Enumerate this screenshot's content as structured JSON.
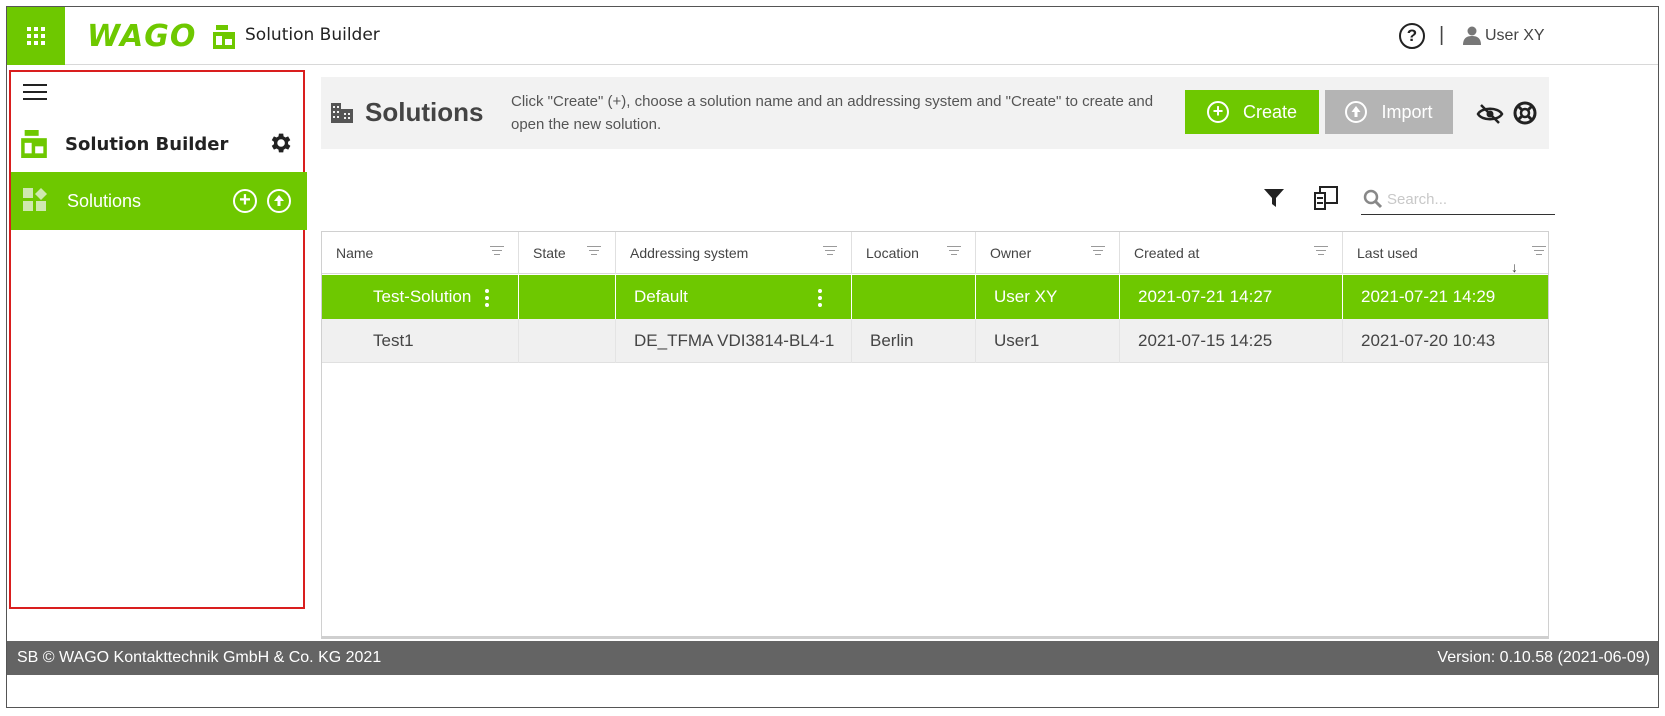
{
  "header": {
    "brand": "WAGO",
    "app_title": "Solution Builder",
    "help_glyph": "?",
    "separator": "|",
    "user_name": "User XY"
  },
  "sidebar": {
    "title": "Solution Builder",
    "items": [
      {
        "label": "Solutions",
        "active": true,
        "icon": "solutions-icon"
      }
    ],
    "add_glyph": "+"
  },
  "main": {
    "title": "Solutions",
    "hint": "Click \"Create\" (+), choose a solution name and an addressing system and \"Create\" to create and open the new solution.",
    "create_label": "Create",
    "import_label": "Import",
    "create_glyph": "+",
    "search_placeholder": "Search..."
  },
  "table": {
    "columns": [
      "Name",
      "State",
      "Addressing system",
      "Location",
      "Owner",
      "Created at",
      "Last used"
    ],
    "sorted_column": "Last used",
    "sort_direction": "descending",
    "sort_glyph": "↓",
    "rows": [
      {
        "name": "Test-Solution",
        "state": "",
        "addressing": "Default",
        "location": "",
        "owner": "User XY",
        "created": "2021-07-21 14:27",
        "last_used": "2021-07-21 14:29",
        "selected": true
      },
      {
        "name": "Test1",
        "state": "",
        "addressing": "DE_TFMA VDI3814-BL4-1",
        "location": "Berlin",
        "owner": "User1",
        "created": "2021-07-15 14:25",
        "last_used": "2021-07-20 10:43",
        "selected": false
      }
    ]
  },
  "footer": {
    "copyright": "SB © WAGO Kontakttechnik GmbH & Co. KG 2021",
    "version": "Version: 0.10.58 (2021-06-09)"
  },
  "colors": {
    "accent": "#6ec800",
    "disabled_button": "#b4b4b4",
    "footer_bg": "#646464",
    "sidebar_outline": "#d91e1e"
  }
}
